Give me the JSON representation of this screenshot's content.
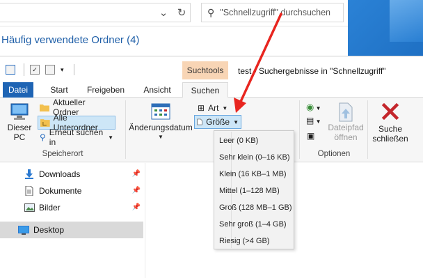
{
  "background_window": {
    "refresh_icon": "↻",
    "search_placeholder": "\"Schnellzugriff\" durchsuchen",
    "heading": "Häufig verwendete Ordner (4)"
  },
  "window": {
    "context_tab_group": "Suchtools",
    "title": "test - Suchergebnisse in \"Schnellzugriff\""
  },
  "tabs": [
    "Datei",
    "Start",
    "Freigeben",
    "Ansicht",
    "Suchen"
  ],
  "ribbon": {
    "speicherort": {
      "this_pc": "Dieser PC",
      "current_folder": "Aktueller Ordner",
      "all_subfolders": "Alle Unterordner",
      "search_again": "Erneut suchen in",
      "label": "Speicherort"
    },
    "refine": {
      "date_modified": "Änderungsdatum",
      "type": "Art",
      "size": "Größe"
    },
    "options": {
      "open_file_location": "Dateipfad öffnen",
      "label": "Optionen"
    },
    "close": {
      "close_search": "Suche schließen"
    }
  },
  "size_menu": [
    "Leer (0 KB)",
    "Sehr klein (0–16 KB)",
    "Klein (16 KB–1 MB)",
    "Mittel (1–128 MB)",
    "Groß (128 MB–1 GB)",
    "Sehr groß (1–4 GB)",
    "Riesig (>4 GB)"
  ],
  "navigation": {
    "items": [
      "Downloads",
      "Dokumente",
      "Bilder"
    ],
    "selected": "Desktop"
  },
  "colors": {
    "accent": "#1e64b4",
    "context_tab": "#f8d5b5",
    "annotation_arrow": "#e8251f",
    "close_x": "#c4262c"
  }
}
